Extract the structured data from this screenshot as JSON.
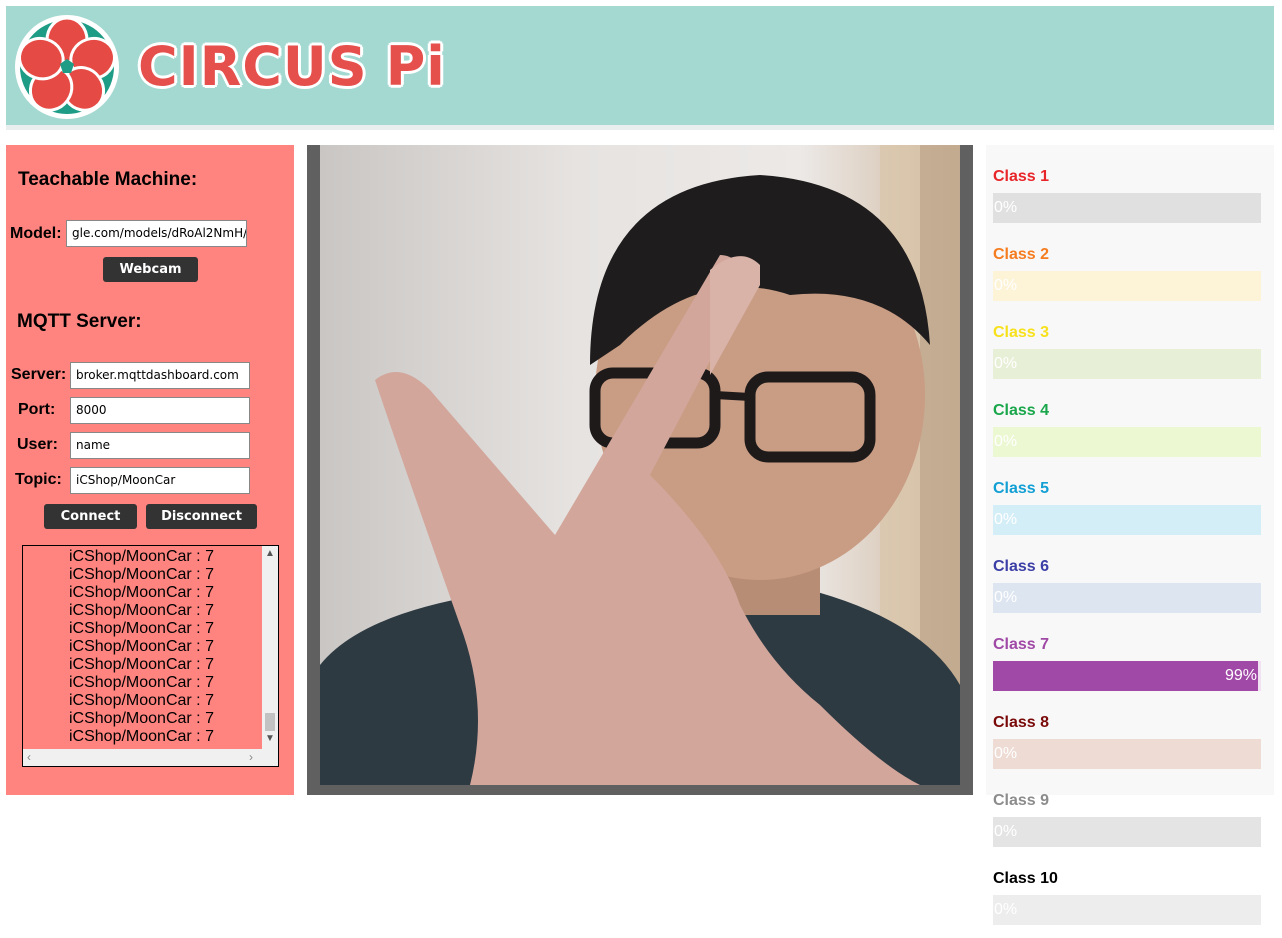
{
  "header": {
    "logo_text_main": "CIRCUS",
    "logo_text_pi": "Pi",
    "background_color": "#a3d9d1"
  },
  "left_panel": {
    "background_color": "#ff8480",
    "teachable_title": "Teachable Machine:",
    "model_label": "Model:",
    "model_value": "gle.com/models/dRoAl2NmH/",
    "webcam_button": "Webcam",
    "mqtt_title": "MQTT Server:",
    "server_label": "Server:",
    "server_value": "broker.mqttdashboard.com",
    "port_label": "Port:",
    "port_value": "8000",
    "user_label": "User:",
    "user_value": "name",
    "topic_label": "Topic:",
    "topic_value": "iCShop/MoonCar",
    "connect_button": "Connect",
    "disconnect_button": "Disconnect",
    "log_lines": [
      "iCShop/MoonCar : 7",
      "iCShop/MoonCar : 7",
      "iCShop/MoonCar : 7",
      "iCShop/MoonCar : 7",
      "iCShop/MoonCar : 7",
      "iCShop/MoonCar : 7",
      "iCShop/MoonCar : 7",
      "iCShop/MoonCar : 7",
      "iCShop/MoonCar : 7",
      "iCShop/MoonCar : 7",
      "iCShop/MoonCar : 7"
    ]
  },
  "classes": [
    {
      "name": "Class 1",
      "label_color": "#e8262a",
      "bar_color": "#e0e0e0",
      "fill_color": "#e8262a",
      "value": 0,
      "text": "0%"
    },
    {
      "name": "Class 2",
      "label_color": "#f57d20",
      "bar_color": "#fdf3d7",
      "fill_color": "#f57d20",
      "value": 0,
      "text": "0%"
    },
    {
      "name": "Class 3",
      "label_color": "#f7e11c",
      "bar_color": "#e7efd6",
      "fill_color": "#f7e11c",
      "value": 0,
      "text": "0%"
    },
    {
      "name": "Class 4",
      "label_color": "#1aa64b",
      "bar_color": "#ecf8d2",
      "fill_color": "#1aa64b",
      "value": 0,
      "text": "0%"
    },
    {
      "name": "Class 5",
      "label_color": "#129fd4",
      "bar_color": "#d4eef7",
      "fill_color": "#129fd4",
      "value": 0,
      "text": "0%"
    },
    {
      "name": "Class 6",
      "label_color": "#3c3fa6",
      "bar_color": "#dde5f0",
      "fill_color": "#3c3fa6",
      "value": 0,
      "text": "0%"
    },
    {
      "name": "Class 7",
      "label_color": "#a049a6",
      "bar_color": "#f1e2f1",
      "fill_color": "#a049a6",
      "value": 99,
      "text": "99%"
    },
    {
      "name": "Class 8",
      "label_color": "#7a0a0a",
      "bar_color": "#eddbd4",
      "fill_color": "#7a0a0a",
      "value": 0,
      "text": "0%"
    },
    {
      "name": "Class 9",
      "label_color": "#8c8c8c",
      "bar_color": "#e4e4e4",
      "fill_color": "#8c8c8c",
      "value": 0,
      "text": "0%"
    },
    {
      "name": "Class 10",
      "label_color": "#000000",
      "bar_color": "#ededed",
      "fill_color": "#000000",
      "value": 0,
      "text": "0%"
    }
  ]
}
